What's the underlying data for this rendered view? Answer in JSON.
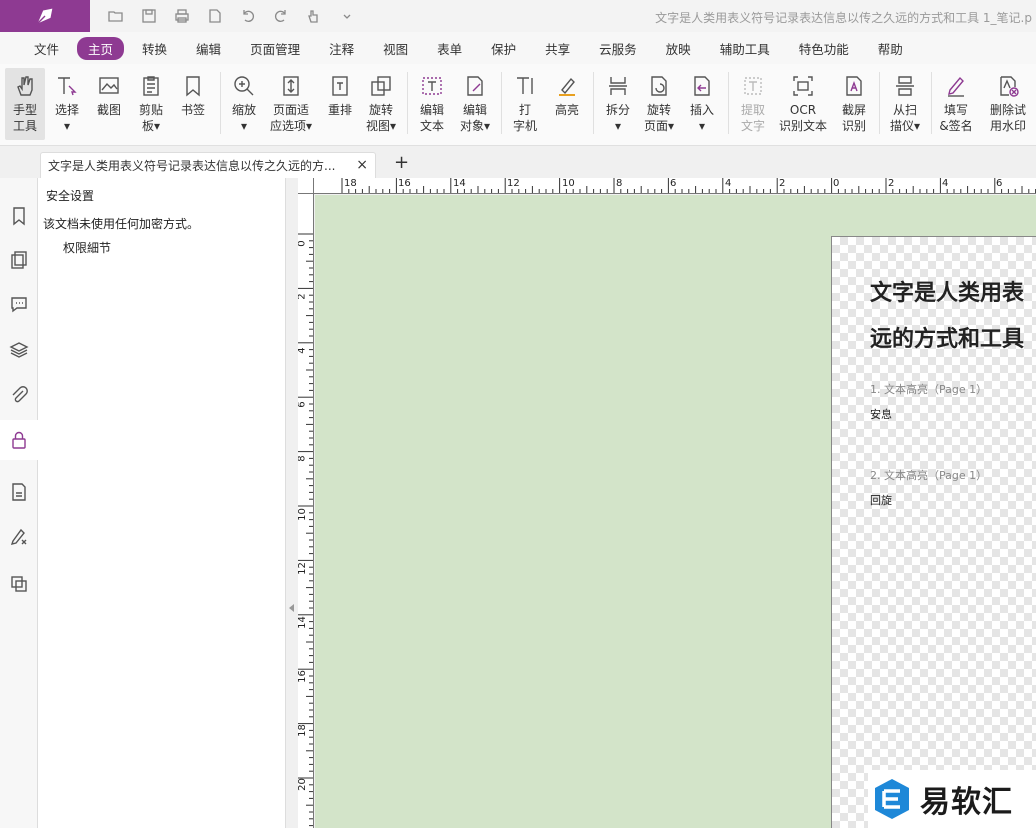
{
  "window": {
    "title": "文字是人类用表义符号记录表达信息以传之久远的方式和工具 1_笔记.p"
  },
  "menu": {
    "items": [
      "文件",
      "主页",
      "转换",
      "编辑",
      "页面管理",
      "注释",
      "视图",
      "表单",
      "保护",
      "共享",
      "云服务",
      "放映",
      "辅助工具",
      "特色功能",
      "帮助"
    ],
    "active_index": 1
  },
  "ribbon": {
    "tools": [
      {
        "label": "手型\n工具",
        "icon": "hand-icon"
      },
      {
        "label": "选择\n▾",
        "icon": "select-text-icon"
      },
      {
        "label": "截图",
        "icon": "screenshot-icon"
      },
      {
        "label": "剪贴\n板▾",
        "icon": "clipboard-icon"
      },
      {
        "label": "书签",
        "icon": "bookmark-icon"
      },
      {
        "label": "缩放\n▾",
        "icon": "zoom-icon"
      },
      {
        "label": "页面适\n应选项▾",
        "icon": "fit-page-icon"
      },
      {
        "label": "重排",
        "icon": "reflow-icon"
      },
      {
        "label": "旋转\n视图▾",
        "icon": "rotate-view-icon"
      },
      {
        "label": "编辑\n文本",
        "icon": "edit-text-icon"
      },
      {
        "label": "编辑\n对象▾",
        "icon": "edit-object-icon"
      },
      {
        "label": "打\n字机",
        "icon": "typewriter-icon"
      },
      {
        "label": "高亮",
        "icon": "highlight-icon"
      },
      {
        "label": "拆分\n▾",
        "icon": "split-icon"
      },
      {
        "label": "旋转\n页面▾",
        "icon": "rotate-page-icon"
      },
      {
        "label": "插入\n▾",
        "icon": "insert-icon"
      },
      {
        "label": "提取\n文字",
        "icon": "extract-text-icon"
      },
      {
        "label": "OCR\n识别文本",
        "icon": "ocr-icon"
      },
      {
        "label": "截屏\n识别",
        "icon": "screen-ocr-icon"
      },
      {
        "label": "从扫\n描仪▾",
        "icon": "scanner-icon"
      },
      {
        "label": "填写\n&签名",
        "icon": "fill-sign-icon"
      },
      {
        "label": "删除试\n用水印",
        "icon": "remove-watermark-icon"
      }
    ]
  },
  "tabs": {
    "doc_title": "文字是人类用表义符号记录表达信息以传之久远的方...",
    "close_glyph": "×",
    "add_glyph": "+"
  },
  "security_panel": {
    "title": "安全设置",
    "message": "该文档未使用任何加密方式。",
    "link": "权限細节"
  },
  "rulers": {
    "horizontal_labels": [
      "18",
      "16",
      "14",
      "12",
      "10",
      "8",
      "6",
      "4",
      "2",
      "0",
      "2",
      "4",
      "6"
    ],
    "vertical_labels": [
      "0",
      "2",
      "4",
      "6",
      "8",
      "10",
      "12",
      "14",
      "16",
      "18",
      "20"
    ]
  },
  "page": {
    "heading_line1": "文字是人类用表",
    "heading_line2": "远的方式和工具",
    "note1_label": "1. 文本高亮（Page 1）",
    "note1_text": "安息",
    "note2_label": "2. 文本高亮（Page 1）",
    "note2_text": "回旋"
  },
  "watermark": {
    "text": "易软汇"
  },
  "colors": {
    "brand": "#8e3a92",
    "canvas": "#d3e4c9"
  }
}
